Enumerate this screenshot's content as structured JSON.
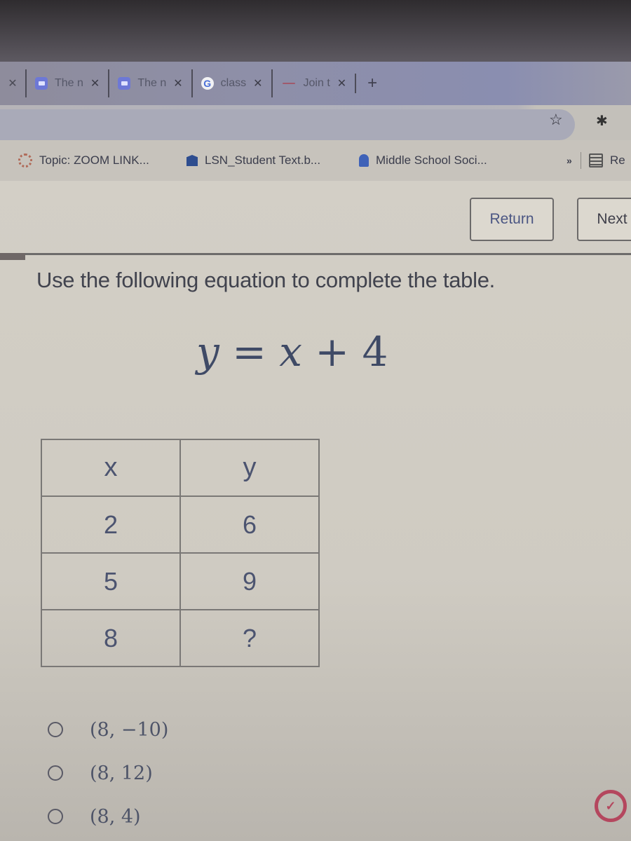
{
  "browser": {
    "tabs": [
      {
        "title": "The n",
        "icon": "zoom-video-icon"
      },
      {
        "title": "The n",
        "icon": "zoom-video-icon"
      },
      {
        "title": "class",
        "icon": "google-g-icon"
      },
      {
        "title": "Join t",
        "icon": "join-link-icon"
      }
    ],
    "close_glyph": "✕",
    "new_tab_glyph": "+",
    "star_glyph": "☆",
    "extension_glyph": "✱",
    "bookmarks": [
      {
        "label": "Topic: ZOOM LINK...",
        "icon": "canvas-ring-icon"
      },
      {
        "label": "LSN_Student Text.b...",
        "icon": "school-logo-icon"
      },
      {
        "label": "Middle School Soci...",
        "icon": "house-icon"
      }
    ],
    "bookmarks_more": "»",
    "reading_list_label": "Re"
  },
  "nav": {
    "return_label": "Return",
    "next_label": "Next",
    "progress_fraction": 0.04
  },
  "question": {
    "prompt": "Use the following equation to complete the table.",
    "equation": {
      "lhs": "y",
      "eq": "=",
      "var": "x",
      "op": "+",
      "const": "4"
    },
    "table": {
      "headers": [
        "x",
        "y"
      ],
      "rows": [
        [
          "2",
          "6"
        ],
        [
          "5",
          "9"
        ],
        [
          "8",
          "?"
        ]
      ]
    },
    "choices": [
      "(8, −10)",
      "(8, 12)",
      "(8, 4)"
    ]
  },
  "badge_glyph": "✓",
  "colors": {
    "accent": "#4b5683",
    "badge": "#b4475e"
  }
}
